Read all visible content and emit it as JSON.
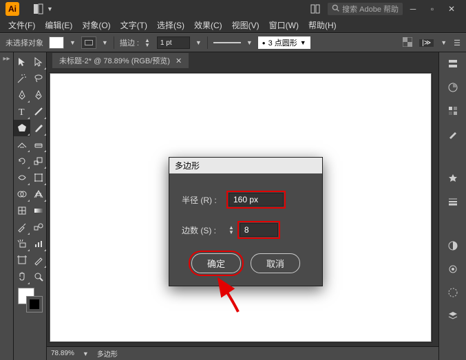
{
  "titlebar": {
    "app_abbr": "Ai",
    "search_placeholder": "搜索 Adobe 帮助"
  },
  "menubar": {
    "file": "文件(F)",
    "edit": "编辑(E)",
    "object": "对象(O)",
    "type": "文字(T)",
    "select": "选择(S)",
    "effect": "效果(C)",
    "view": "视图(V)",
    "window": "窗口(W)",
    "help": "帮助(H)"
  },
  "optionsbar": {
    "no_selection": "未选择对象",
    "stroke_label": "描边 :",
    "stroke_value": "1 pt",
    "profile_value": "3 点圆形"
  },
  "doc": {
    "tab_title": "未标题-2* @ 78.89% (RGB/预览)"
  },
  "status": {
    "zoom": "78.89%",
    "mode": "多边形"
  },
  "dialog": {
    "title": "多边形",
    "radius_label": "半径 (R) :",
    "radius_value": "160 px",
    "sides_label": "边数 (S) :",
    "sides_value": "8",
    "ok_label": "确定",
    "cancel_label": "取消"
  }
}
